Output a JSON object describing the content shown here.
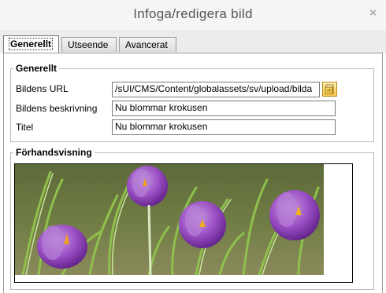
{
  "dialog": {
    "title": "Infoga/redigera bild",
    "close_glyph": "×"
  },
  "tabs": [
    {
      "label": "Generellt",
      "active": true
    },
    {
      "label": "Utseende",
      "active": false
    },
    {
      "label": "Avancerat",
      "active": false
    }
  ],
  "general": {
    "legend": "Generellt",
    "url_label": "Bildens URL",
    "url_value": "/sUI/CMS/Content/globalassets/sv/upload/bilda",
    "description_label": "Bildens beskrivning",
    "description_value": "Nu blommar krokusen",
    "title_label": "Titel",
    "title_value": "Nu blommar krokusen",
    "browse_icon": "browse-folder-icon"
  },
  "preview": {
    "legend": "Förhandsvisning",
    "image": "purple-crocus-flowers-photo"
  },
  "colors": {
    "accent_border": "#9a9a9a",
    "browse_button": "#f2c84a",
    "crocus_purple": "#8e3fb5"
  }
}
